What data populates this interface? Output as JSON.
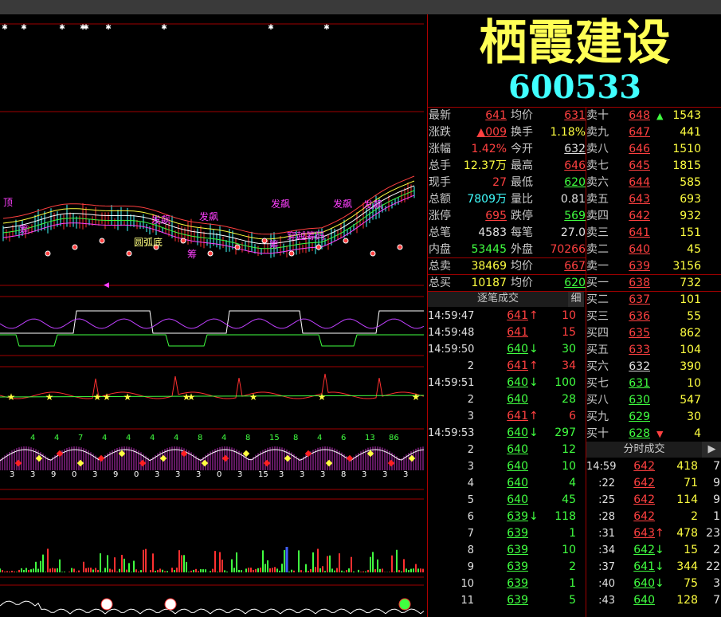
{
  "stock": {
    "name": "栖霞建设",
    "code": "600533"
  },
  "quote_left": [
    {
      "label": "最新",
      "value": "641",
      "cls": "red ul",
      "label2": "均价",
      "value2": "631",
      "cls2": "red ul"
    },
    {
      "label": "涨跌",
      "value": "▲009",
      "cls": "red ul",
      "label2": "换手",
      "value2": "1.18%",
      "cls2": "yellow"
    },
    {
      "label": "涨幅",
      "value": "1.42%",
      "cls": "red",
      "label2": "今开",
      "value2": "632",
      "cls2": "white ul"
    },
    {
      "label": "总手",
      "value": "12.37万",
      "cls": "yellow",
      "label2": "最高",
      "value2": "646",
      "cls2": "red ul"
    },
    {
      "label": "现手",
      "value": "27",
      "cls": "red",
      "label2": "最低",
      "value2": "620",
      "cls2": "green ul"
    },
    {
      "label": "总额",
      "value": "7809万",
      "cls": "cyan",
      "label2": "量比",
      "value2": "0.81",
      "cls2": "white"
    },
    {
      "label": "涨停",
      "value": "695",
      "cls": "red ul",
      "label2": "跌停",
      "value2": "569",
      "cls2": "green ul"
    },
    {
      "label": "总笔",
      "value": "4583",
      "cls": "white",
      "label2": "每笔",
      "value2": "27.0",
      "cls2": "white"
    },
    {
      "label": "内盘",
      "value": "53445",
      "cls": "green",
      "label2": "外盘",
      "value2": "70266",
      "cls2": "red"
    },
    {
      "label": "总卖",
      "value": "38469",
      "cls": "yellow",
      "label2": "均价",
      "value2": "667",
      "cls2": "red ul"
    },
    {
      "label": "总买",
      "value": "10187",
      "cls": "yellow",
      "label2": "均价",
      "value2": "620",
      "cls2": "green ul"
    }
  ],
  "order_book": [
    {
      "label": "卖十",
      "price": "648",
      "pcls": "red ul",
      "vol": "1543",
      "arrow": "▲"
    },
    {
      "label": "卖九",
      "price": "647",
      "pcls": "red ul",
      "vol": "441",
      "arrow": ""
    },
    {
      "label": "卖八",
      "price": "646",
      "pcls": "red ul",
      "vol": "1510",
      "arrow": ""
    },
    {
      "label": "卖七",
      "price": "645",
      "pcls": "red ul",
      "vol": "1815",
      "arrow": ""
    },
    {
      "label": "卖六",
      "price": "644",
      "pcls": "red ul",
      "vol": "585",
      "arrow": ""
    },
    {
      "label": "卖五",
      "price": "643",
      "pcls": "red ul",
      "vol": "693",
      "arrow": ""
    },
    {
      "label": "卖四",
      "price": "642",
      "pcls": "red ul",
      "vol": "932",
      "arrow": ""
    },
    {
      "label": "卖三",
      "price": "641",
      "pcls": "red ul",
      "vol": "151",
      "arrow": ""
    },
    {
      "label": "卖二",
      "price": "640",
      "pcls": "red ul",
      "vol": "45",
      "arrow": ""
    },
    {
      "label": "卖一",
      "price": "639",
      "pcls": "red ul",
      "vol": "3156",
      "arrow": ""
    },
    {
      "label": "买一",
      "price": "638",
      "pcls": "red ul",
      "vol": "732",
      "arrow": ""
    },
    {
      "label": "买二",
      "price": "637",
      "pcls": "red ul",
      "vol": "101",
      "arrow": ""
    },
    {
      "label": "买三",
      "price": "636",
      "pcls": "red ul",
      "vol": "55",
      "arrow": ""
    },
    {
      "label": "买四",
      "price": "635",
      "pcls": "red ul",
      "vol": "862",
      "arrow": ""
    },
    {
      "label": "买五",
      "price": "633",
      "pcls": "red ul",
      "vol": "104",
      "arrow": ""
    },
    {
      "label": "买六",
      "price": "632",
      "pcls": "white ul",
      "vol": "390",
      "arrow": ""
    },
    {
      "label": "买七",
      "price": "631",
      "pcls": "green ul",
      "vol": "10",
      "arrow": ""
    },
    {
      "label": "买八",
      "price": "630",
      "pcls": "green ul",
      "vol": "547",
      "arrow": ""
    },
    {
      "label": "买九",
      "price": "629",
      "pcls": "green ul",
      "vol": "30",
      "arrow": ""
    },
    {
      "label": "买十",
      "price": "628",
      "pcls": "green ul",
      "vol": "4",
      "arrow": "▼"
    }
  ],
  "tick_panel": {
    "title": "逐笔成交",
    "btn": "细",
    "rows": [
      {
        "t": "14:59:47",
        "p": "641",
        "a": "↑",
        "v": "10",
        "c": "red"
      },
      {
        "t": "14:59:48",
        "p": "641",
        "a": "",
        "v": "15",
        "c": "red"
      },
      {
        "t": "14:59:50",
        "p": "640",
        "a": "↓",
        "v": "30",
        "c": "green"
      },
      {
        "t": "2",
        "p": "641",
        "a": "↑",
        "v": "34",
        "c": "red"
      },
      {
        "t": "14:59:51",
        "p": "640",
        "a": "↓",
        "v": "100",
        "c": "green"
      },
      {
        "t": "2",
        "p": "640",
        "a": "",
        "v": "28",
        "c": "green"
      },
      {
        "t": "3",
        "p": "641",
        "a": "↑",
        "v": "6",
        "c": "red"
      },
      {
        "t": "14:59:53",
        "p": "640",
        "a": "↓",
        "v": "297",
        "c": "green"
      },
      {
        "t": "2",
        "p": "640",
        "a": "",
        "v": "12",
        "c": "green"
      },
      {
        "t": "3",
        "p": "640",
        "a": "",
        "v": "10",
        "c": "green"
      },
      {
        "t": "4",
        "p": "640",
        "a": "",
        "v": "4",
        "c": "green"
      },
      {
        "t": "5",
        "p": "640",
        "a": "",
        "v": "45",
        "c": "green"
      },
      {
        "t": "6",
        "p": "639",
        "a": "↓",
        "v": "118",
        "c": "green"
      },
      {
        "t": "7",
        "p": "639",
        "a": "",
        "v": "1",
        "c": "green"
      },
      {
        "t": "8",
        "p": "639",
        "a": "",
        "v": "10",
        "c": "green"
      },
      {
        "t": "9",
        "p": "639",
        "a": "",
        "v": "2",
        "c": "green"
      },
      {
        "t": "10",
        "p": "639",
        "a": "",
        "v": "1",
        "c": "green"
      },
      {
        "t": "11",
        "p": "639",
        "a": "",
        "v": "5",
        "c": "green"
      }
    ]
  },
  "minute_panel": {
    "title": "分时成交",
    "rows": [
      {
        "t": "14:59",
        "p": "642",
        "a": "",
        "v": "418",
        "n": "7",
        "c": "red"
      },
      {
        "t": ":22",
        "p": "642",
        "a": "",
        "v": "71",
        "n": "9",
        "c": "red"
      },
      {
        "t": ":25",
        "p": "642",
        "a": "",
        "v": "114",
        "n": "9",
        "c": "red"
      },
      {
        "t": ":28",
        "p": "642",
        "a": "",
        "v": "2",
        "n": "1",
        "c": "red"
      },
      {
        "t": ":31",
        "p": "643",
        "a": "↑",
        "v": "478",
        "n": "23",
        "c": "red"
      },
      {
        "t": ":34",
        "p": "642",
        "a": "↓",
        "v": "15",
        "n": "2",
        "c": "green"
      },
      {
        "t": ":37",
        "p": "641",
        "a": "↓",
        "v": "344",
        "n": "22",
        "c": "green"
      },
      {
        "t": ":40",
        "p": "640",
        "a": "↓",
        "v": "75",
        "n": "3",
        "c": "green"
      },
      {
        "t": ":43",
        "p": "640",
        "a": "",
        "v": "128",
        "n": "7",
        "c": "green"
      }
    ]
  },
  "chart_labels": {
    "main": [
      "顶",
      "发飙",
      "发飙",
      "发飙",
      "发飙",
      "发飙",
      "圆弧底",
      "筹",
      "筹",
      "筹",
      "穿越筹码"
    ],
    "kdj_digits": [
      "4",
      "4",
      "7",
      "4",
      "4",
      "4",
      "4",
      "8",
      "4",
      "8",
      "15",
      "8",
      "4",
      "6",
      "13",
      "86"
    ],
    "osc_digits": [
      "3",
      "3",
      "9",
      "0",
      "3",
      "9",
      "0",
      "3",
      "3",
      "3",
      "0",
      "3",
      "15",
      "3",
      "3",
      "3",
      "8",
      "3",
      "3",
      "3"
    ]
  },
  "colors": {
    "up": "#ff4040",
    "down": "#40ff40",
    "accent": "#ffff55",
    "code": "#40ffff",
    "grid": "#a00000"
  }
}
